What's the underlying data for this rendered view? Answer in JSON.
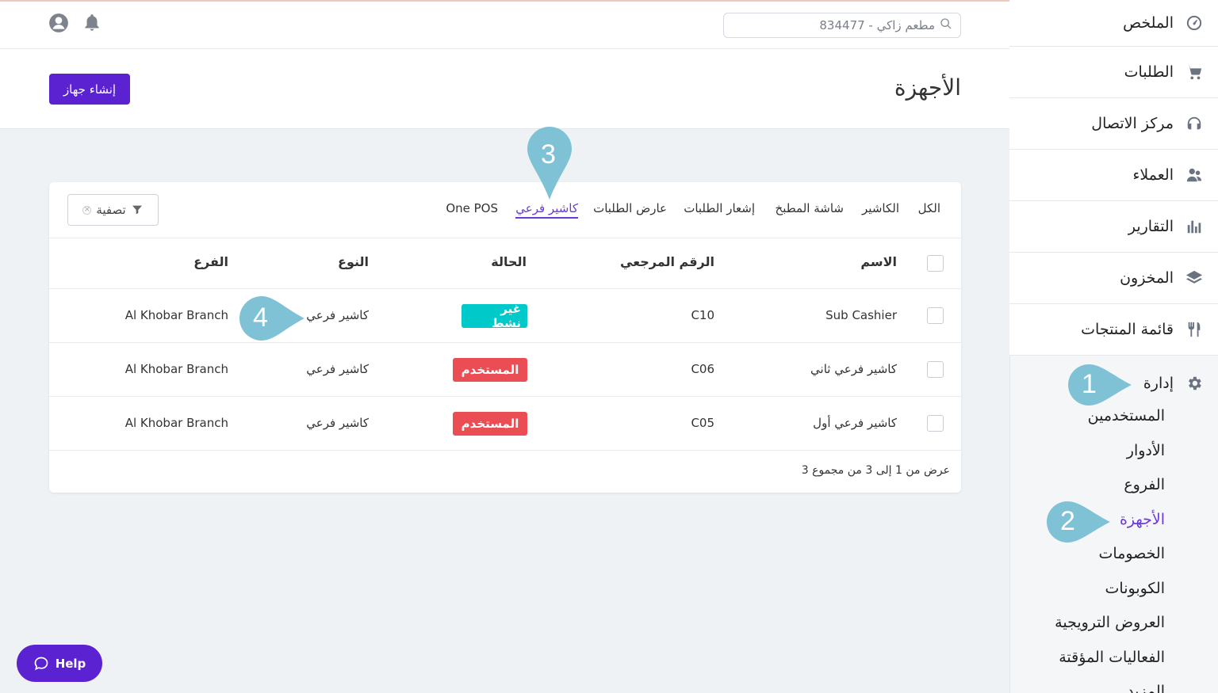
{
  "sidebar": {
    "items": [
      {
        "label": "الملخص",
        "icon": "dashboard-gauge-icon"
      },
      {
        "label": "الطلبات",
        "icon": "shopping-cart-icon"
      },
      {
        "label": "مركز الاتصال",
        "icon": "headset-icon"
      },
      {
        "label": "العملاء",
        "icon": "customers-icon"
      },
      {
        "label": "التقارير",
        "icon": "bar-chart-icon"
      },
      {
        "label": "المخزون",
        "icon": "layers-icon"
      },
      {
        "label": "قائمة المنتجات",
        "icon": "fork-knife-icon"
      }
    ],
    "admin": {
      "label": "إدارة",
      "icon": "gear-icon",
      "subitems": [
        "المستخدمين",
        "الأدوار",
        "الفروع",
        "الأجهزة",
        "الخصومات",
        "الكوبونات",
        "العروض الترويجية",
        "الفعاليات المؤقتة",
        "المزيد"
      ],
      "active": "الأجهزة"
    }
  },
  "topbar": {
    "search_value": "مطعم زاكي - 834477",
    "icons": [
      "bell-icon",
      "user-avatar-icon"
    ]
  },
  "header": {
    "title": "الأجهزة",
    "create_button": "إنشاء جهاز"
  },
  "tabs": [
    "الكل",
    "الكاشير",
    "شاشة المطبخ",
    "إشعار الطلبات",
    "عارض الطلبات",
    "كاشير فرعي",
    "One POS"
  ],
  "active_tab": "كاشير فرعي",
  "filter": {
    "label": "تصفية"
  },
  "table": {
    "columns": {
      "name": "الاسم",
      "ref": "الرقم المرجعي",
      "status": "الحالة",
      "type": "النوع",
      "branch": "الفرع"
    },
    "rows": [
      {
        "name": "Sub Cashier",
        "ref": "C10",
        "status": "غير نشط",
        "type": "كاشير فرعي",
        "branch": "Al Khobar Branch"
      },
      {
        "name": "كاشير فرعي ثاني",
        "ref": "C06",
        "status": "المستخدم",
        "type": "كاشير فرعي",
        "branch": "Al Khobar Branch"
      },
      {
        "name": "كاشير فرعي أول",
        "ref": "C05",
        "status": "المستخدم",
        "type": "كاشير فرعي",
        "branch": "Al Khobar Branch"
      }
    ],
    "footer": "عرض من 1 إلى 3 من مجموع 3"
  },
  "help": {
    "label": "Help"
  },
  "markers": [
    "1",
    "2",
    "3",
    "4"
  ],
  "colors": {
    "accent": "#5b22d1",
    "active_link": "#6a3ad8",
    "inactive_badge": "#00c9c9",
    "used_badge": "#ea4e54",
    "marker": "#7fc2d6"
  }
}
